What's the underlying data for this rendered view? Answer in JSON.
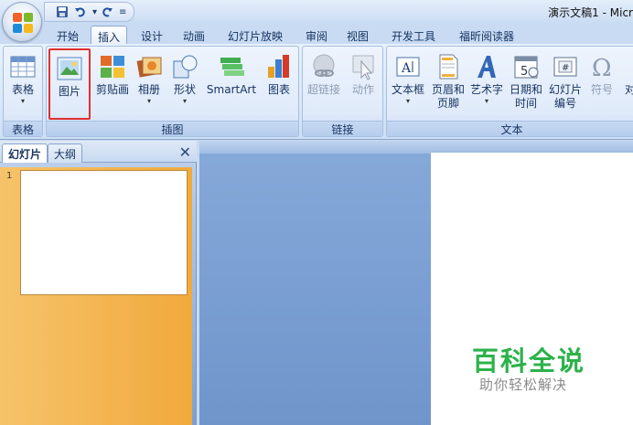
{
  "window": {
    "title": "演示文稿1 - Micr"
  },
  "tabs": [
    "开始",
    "插入",
    "设计",
    "动画",
    "幻灯片放映",
    "审阅",
    "视图",
    "开发工具",
    "福昕阅读器"
  ],
  "active_tab": "插入",
  "ribbon": {
    "groups": {
      "tables": {
        "label": "表格",
        "buttons": {
          "table": "表格"
        }
      },
      "illustrations": {
        "label": "插图",
        "buttons": {
          "picture": "图片",
          "clipart": "剪贴画",
          "album": "相册",
          "shapes": "形状",
          "smartart": "SmartArt",
          "chart": "图表"
        }
      },
      "links": {
        "label": "链接",
        "buttons": {
          "hyperlink": "超链接",
          "action": "动作"
        }
      },
      "text": {
        "label": "文本",
        "buttons": {
          "textbox": "文本框",
          "header_l1": "页眉和",
          "header_l2": "页脚",
          "wordart": "艺术字",
          "datetime_l1": "日期和",
          "datetime_l2": "时间",
          "slidenum_l1": "幻灯片",
          "slidenum_l2": "编号",
          "symbol": "符号",
          "object": "对"
        }
      }
    }
  },
  "pane": {
    "tab_slides": "幻灯片",
    "tab_outline": "大纲",
    "close": "✕",
    "slide_number": "1"
  },
  "watermark": {
    "title": "百科全说",
    "subtitle": "助你轻松解决"
  },
  "colors": {
    "highlight": "#e03030",
    "watermark_green": "#2cb24a",
    "thumb_selected": "#f1a93c"
  }
}
